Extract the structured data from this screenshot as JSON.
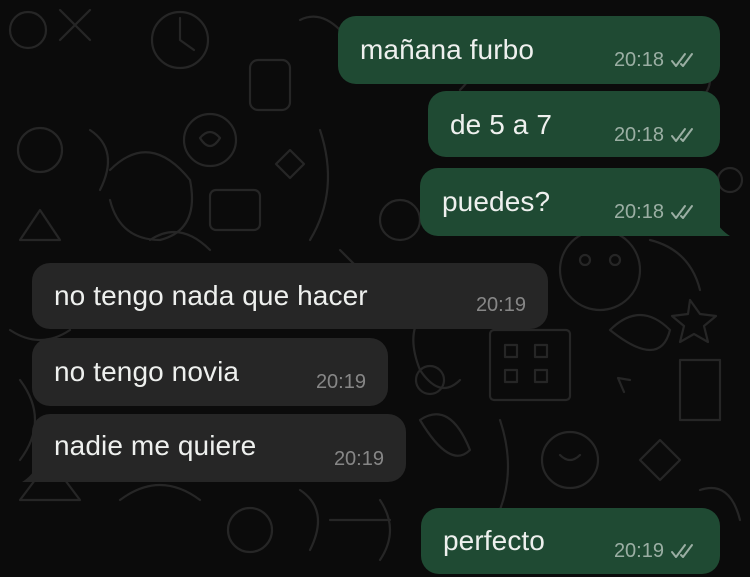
{
  "colors": {
    "outgoing_bubble": "#1f4a33",
    "incoming_bubble": "#262626",
    "background": "#0b0b0b",
    "text": "#eef0ee"
  },
  "messages": [
    {
      "direction": "outgoing",
      "text": "mañana furbo",
      "time": "20:18",
      "status": "read-ticks-icon"
    },
    {
      "direction": "outgoing",
      "text": "de 5 a 7",
      "time": "20:18",
      "status": "read-ticks-icon"
    },
    {
      "direction": "outgoing",
      "text": "puedes?",
      "time": "20:18",
      "status": "read-ticks-icon"
    },
    {
      "direction": "incoming",
      "text": "no tengo nada que hacer",
      "time": "20:19"
    },
    {
      "direction": "incoming",
      "text": "no tengo novia",
      "time": "20:19"
    },
    {
      "direction": "incoming",
      "text": "nadie me quiere",
      "time": "20:19"
    },
    {
      "direction": "outgoing",
      "text": "perfecto",
      "time": "20:19",
      "status": "read-ticks-icon"
    }
  ]
}
